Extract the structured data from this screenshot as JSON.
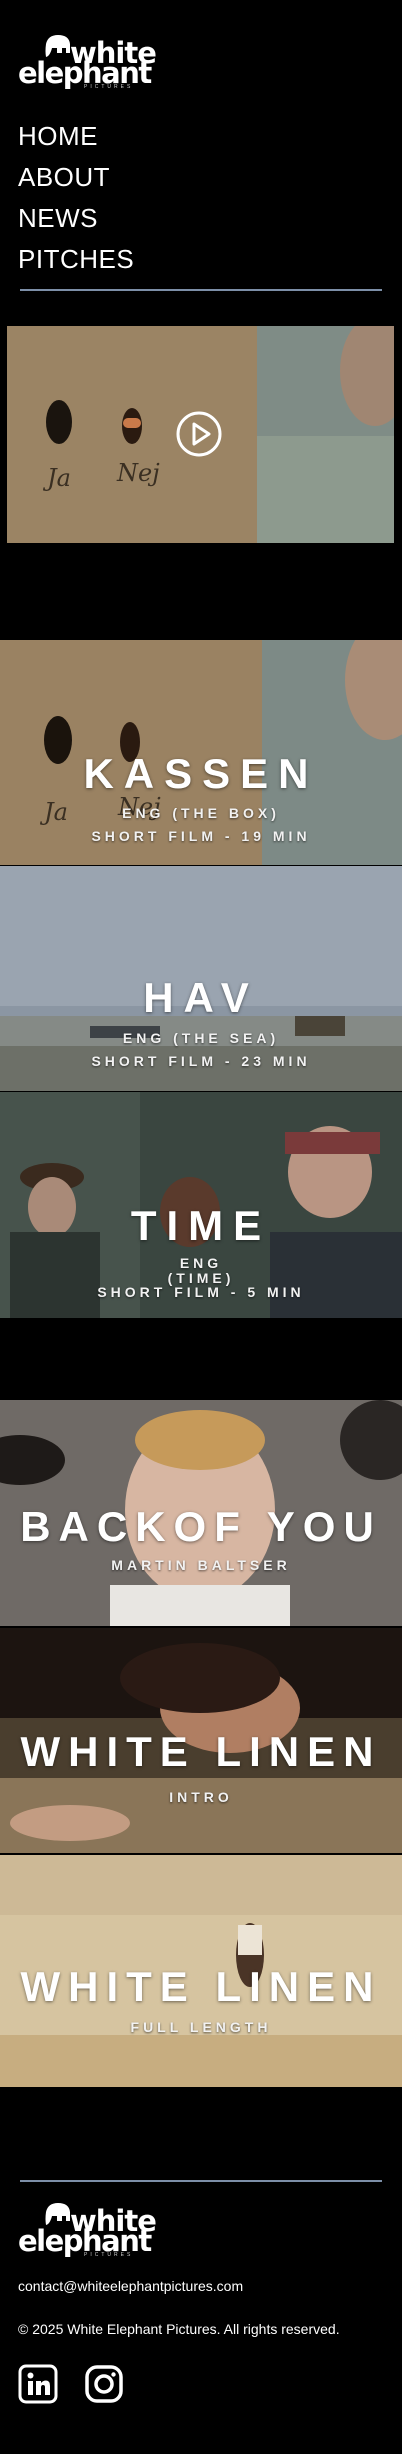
{
  "logo": {
    "word1": "white",
    "word2": "elephant",
    "sub": "PICTURES"
  },
  "nav": [
    "HOME",
    "ABOUT",
    "NEWS",
    "PITCHES"
  ],
  "video": {
    "play_label": "Play video"
  },
  "films": [
    {
      "title": "KASSEN",
      "line1": "ENG (THE BOX)",
      "line2": "SHORT FILM - 19 MIN"
    },
    {
      "title": "HAV",
      "line1": "ENG (THE SEA)",
      "line2": "SHORT FILM - 23 MIN"
    },
    {
      "title": "TIME",
      "line1": "ENG",
      "line1b": "(TIME)",
      "line2": "SHORT FILM - 5 MIN"
    }
  ],
  "works": [
    {
      "title": "BACKOF YOU",
      "sub": "MARTIN BALTSER"
    },
    {
      "title": "WHITE LINEN",
      "sub": "INTRO"
    },
    {
      "title": "WHITE LINEN",
      "sub": "FULL LENGTH"
    }
  ],
  "footer": {
    "email": "contact@whiteelephantpictures.com",
    "copyright": "© 2025 White Elephant Pictures. All rights reserved.",
    "social": [
      "linkedin-icon",
      "instagram-icon"
    ]
  },
  "colors": {
    "background": "#000000",
    "rule": "#7d8fa8",
    "text": "#ffffff"
  }
}
